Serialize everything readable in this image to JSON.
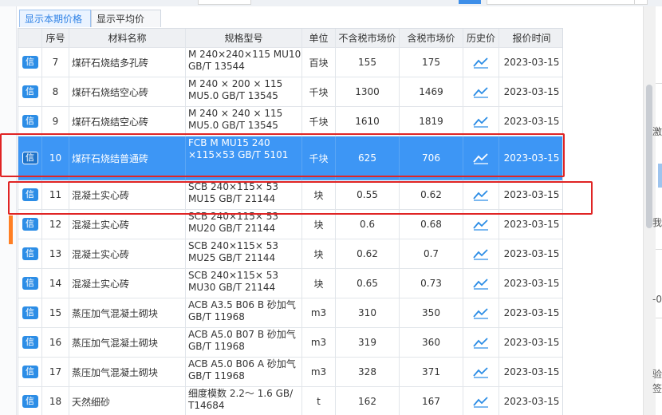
{
  "tabs": [
    {
      "label": "显示本期价格",
      "active": true
    },
    {
      "label": "显示平均价",
      "active": false
    }
  ],
  "columns": [
    "序号",
    "材料名称",
    "规格型号",
    "单位",
    "不含税市场价",
    "含税市场价",
    "历史价",
    "报价时间"
  ],
  "rows": [
    {
      "badge": "信",
      "no": "7",
      "name": "煤矸石烧结多孔砖",
      "spec": "M 240×240×115 MU10 GB/T 13544",
      "unit": "百块",
      "price_ex": "155",
      "price_inc": "175",
      "date": "2023-03-15",
      "selected": false
    },
    {
      "badge": "信",
      "no": "8",
      "name": "煤矸石烧结空心砖",
      "spec": "M  240 × 200 × 115 MU5.0 GB/T 13545",
      "unit": "千块",
      "price_ex": "1300",
      "price_inc": "1469",
      "date": "2023-03-15",
      "selected": false
    },
    {
      "badge": "信",
      "no": "9",
      "name": "煤矸石烧结空心砖",
      "spec": "M  240 × 240 × 115 MU5.0 GB/T 13545",
      "unit": "千块",
      "price_ex": "1610",
      "price_inc": "1819",
      "date": "2023-03-15",
      "selected": false
    },
    {
      "badge": "信",
      "no": "10",
      "name": "煤矸石烧结普通砖",
      "spec": "FCB M MU15 240 ×115×53 GB/T 5101",
      "unit": "千块",
      "price_ex": "625",
      "price_inc": "706",
      "date": "2023-03-15",
      "selected": true
    },
    {
      "badge": "信",
      "no": "11",
      "name": "混凝土实心砖",
      "spec": "SCB 240×115× 53  MU15  GB/T 21144",
      "unit": "块",
      "price_ex": "0.55",
      "price_inc": "0.62",
      "date": "2023-03-15",
      "selected": false
    },
    {
      "badge": "信",
      "no": "12",
      "name": "混凝土实心砖",
      "spec": "SCB 240×115× 53  MU20  GB/T 21144",
      "unit": "块",
      "price_ex": "0.6",
      "price_inc": "0.68",
      "date": "2023-03-15",
      "selected": false
    },
    {
      "badge": "信",
      "no": "13",
      "name": "混凝土实心砖",
      "spec": "SCB 240×115× 53  MU25  GB/T 21144",
      "unit": "块",
      "price_ex": "0.62",
      "price_inc": "0.7",
      "date": "2023-03-15",
      "selected": false
    },
    {
      "badge": "信",
      "no": "14",
      "name": "混凝土实心砖",
      "spec": "SCB 240×115× 53  MU30  GB/T 21144",
      "unit": "块",
      "price_ex": "0.65",
      "price_inc": "0.73",
      "date": "2023-03-15",
      "selected": false
    },
    {
      "badge": "信",
      "no": "15",
      "name": "蒸压加气混凝土砌块",
      "spec": "ACB A3.5 B06 B 砂加气 GB/T 11968",
      "unit": "m3",
      "price_ex": "310",
      "price_inc": "350",
      "date": "2023-03-15",
      "selected": false
    },
    {
      "badge": "信",
      "no": "16",
      "name": "蒸压加气混凝土砌块",
      "spec": "ACB A5.0 B07 B 砂加气 GB/T 11968",
      "unit": "m3",
      "price_ex": "319",
      "price_inc": "360",
      "date": "2023-03-15",
      "selected": false
    },
    {
      "badge": "信",
      "no": "17",
      "name": "蒸压加气混凝土砌块",
      "spec": "ACB A5.0 B06 A 砂加气 GB/T 11968",
      "unit": "m3",
      "price_ex": "328",
      "price_inc": "371",
      "date": "2023-03-15",
      "selected": false
    },
    {
      "badge": "信",
      "no": "18",
      "name": "天然细砂",
      "spec": "细度模数 2.2～ 1.6 GB/ T14684",
      "unit": "t",
      "price_ex": "162",
      "price_inc": "167",
      "date": "2023-03-15",
      "selected": false
    }
  ],
  "right_fragments": [
    "激",
    "我",
    "-0",
    "验",
    "签"
  ],
  "colors": {
    "accent": "#2f82e6",
    "selected_row": "#3d96f5",
    "highlight_border": "#e02424",
    "badge": "#2c8de6"
  }
}
